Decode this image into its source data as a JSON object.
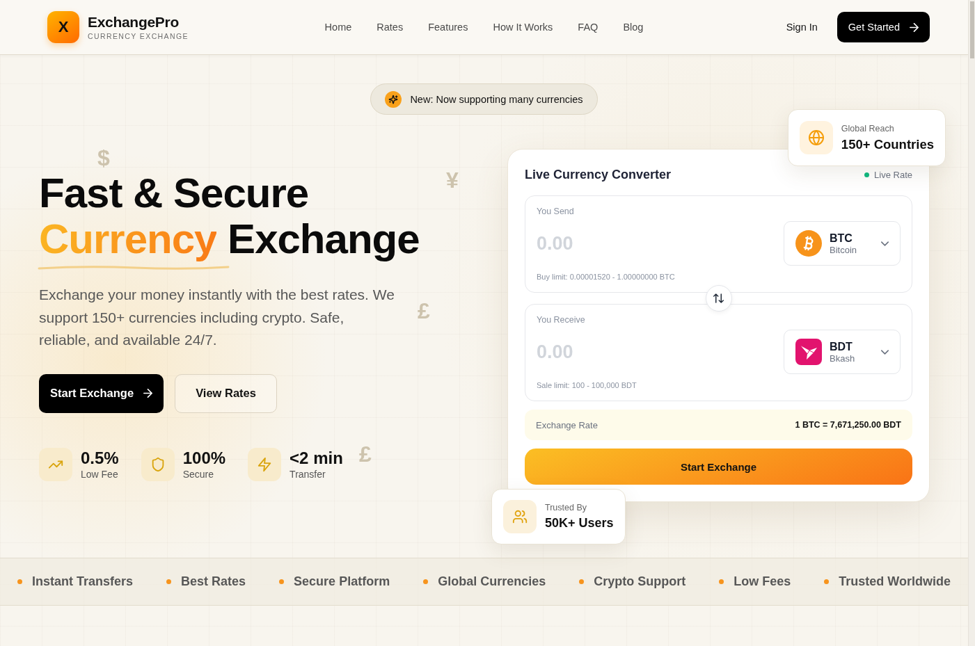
{
  "header": {
    "logo": {
      "mark": "X",
      "name": "ExchangePro",
      "tagline": "CURRENCY EXCHANGE"
    },
    "nav": [
      {
        "label": "Home"
      },
      {
        "label": "Rates"
      },
      {
        "label": "Features"
      },
      {
        "label": "How It Works"
      },
      {
        "label": "FAQ"
      },
      {
        "label": "Blog"
      }
    ],
    "sign_in": "Sign In",
    "cta": "Get Started"
  },
  "hero": {
    "announcement": "New: Now supporting many currencies",
    "title": {
      "line1": "Fast & Secure",
      "highlight": "Currency",
      "rest": "Exchange"
    },
    "description": "Exchange your money instantly with the best rates. We support 150+ currencies including crypto. Safe, reliable, and available 24/7.",
    "buttons": [
      {
        "label": "Start Exchange",
        "kind": "primary"
      },
      {
        "label": "View Rates",
        "kind": "secondary"
      }
    ],
    "stats": [
      {
        "value": "0.5%",
        "label": "Low Fee"
      },
      {
        "value": "100%",
        "label": "Secure"
      },
      {
        "value": "<2 min",
        "label": "Transfer"
      }
    ],
    "background_symbols": [
      "$",
      "¥",
      "£",
      "£"
    ]
  },
  "converter": {
    "title": "Live Currency Converter",
    "status": "Live Rate",
    "send": {
      "label": "You Send",
      "placeholder": "0.00",
      "currency": {
        "code": "BTC",
        "name": "Bitcoin"
      },
      "limit": "Buy limit: 0.00001520 - 1.00000000 BTC"
    },
    "receive": {
      "label": "You Receive",
      "placeholder": "0.00",
      "currency": {
        "code": "BDT",
        "name": "Bkash"
      },
      "limit": "Sale limit: 100 - 100,000 BDT"
    },
    "rate": {
      "label": "Exchange Rate",
      "value": "1 BTC = 7,671,250.00 BDT"
    },
    "submit": "Start Exchange"
  },
  "global_reach": {
    "label": "Global Reach",
    "value": "150+ Countries"
  },
  "trusted": {
    "label": "Trusted By",
    "value": "50K+ Users"
  },
  "ticker": [
    "Instant Transfers",
    "Best Rates",
    "Secure Platform",
    "Global Currencies",
    "Crypto Support",
    "Low Fees",
    "Trusted Worldwide"
  ]
}
